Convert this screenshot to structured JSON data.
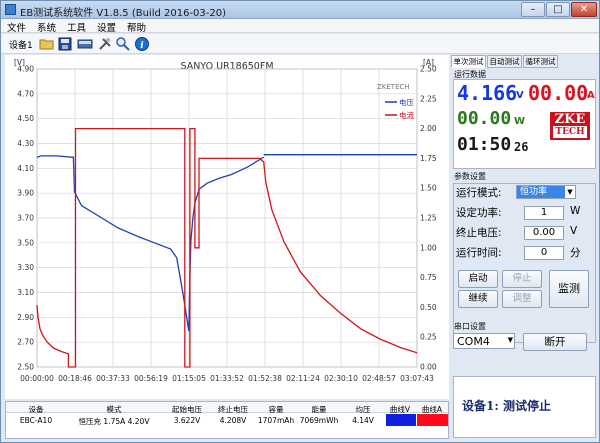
{
  "title": "EB测试系统软件 V1.8.5 (Build 2016-03-20)",
  "window_buttons": {
    "min": "–",
    "max": "□",
    "close": "✕"
  },
  "menu": [
    "文件",
    "系统",
    "工具",
    "设置",
    "帮助"
  ],
  "device_tab": "设备1",
  "toolbar_icons": [
    "open-folder-icon",
    "save-disk-icon",
    "monitor-icon",
    "tools-icon",
    "zoom-icon",
    "info-icon"
  ],
  "chart_data": {
    "type": "line",
    "title": "SANYO UR18650FM",
    "watermark": "ZKETECH",
    "left_unit": "[V]",
    "right_unit": "[A]",
    "y_left_ticks": [
      "4.90",
      "4.70",
      "4.50",
      "4.30",
      "4.10",
      "3.90",
      "3.70",
      "3.50",
      "3.30",
      "3.10",
      "2.90",
      "2.70",
      "2.50"
    ],
    "y_right_ticks": [
      "2.50",
      "2.25",
      "2.00",
      "1.75",
      "1.50",
      "1.25",
      "1.00",
      "0.75",
      "0.50",
      "0.25",
      "0.00"
    ],
    "x_ticks": [
      "00:00:00",
      "00:18:46",
      "00:37:33",
      "00:56:19",
      "01:15:05",
      "01:33:52",
      "01:52:38",
      "02:11:24",
      "02:30:10",
      "02:48:57",
      "03:07:43"
    ],
    "ylim_left": [
      2.5,
      4.9
    ],
    "ylim_right": [
      0,
      2.5
    ],
    "legend": [
      {
        "name": "电压",
        "color": "#1f3fb6"
      },
      {
        "name": "电流",
        "color": "#d0161b"
      }
    ],
    "series": [
      {
        "name": "电压",
        "axis": "left",
        "color": "#1f3fb6",
        "x_minutes": [
          0,
          2,
          10,
          17,
          18,
          18.5,
          22,
          26,
          32,
          40,
          50,
          58,
          66,
          69,
          72,
          75,
          75.5,
          76,
          77,
          78,
          80,
          84,
          90,
          96,
          100,
          104,
          108,
          112
        ],
        "values": [
          4.19,
          4.2,
          4.2,
          4.19,
          4.19,
          3.91,
          3.8,
          3.76,
          3.7,
          3.62,
          3.55,
          3.5,
          3.45,
          3.38,
          3.1,
          2.79,
          3.22,
          3.52,
          3.7,
          3.82,
          3.93,
          3.98,
          4.02,
          4.05,
          4.08,
          4.11,
          4.15,
          4.19
        ]
      },
      {
        "name": "电压",
        "axis": "left",
        "color": "#1f3fb6",
        "x_minutes": [
          112,
          150,
          187.7
        ],
        "values": [
          4.21,
          4.21,
          4.21
        ]
      },
      {
        "name": "电流",
        "axis": "right",
        "color": "#d0161b",
        "x_minutes": [
          0,
          0.5,
          1.5,
          3,
          5,
          8,
          12,
          15.5,
          15.5,
          19,
          19,
          73,
          73,
          75.5,
          75.5,
          78,
          78,
          80,
          80,
          110,
          112,
          113,
          116,
          122,
          130,
          140,
          150,
          160,
          170,
          180,
          187.7
        ],
        "values": [
          0.52,
          0.42,
          0.32,
          0.26,
          0.21,
          0.16,
          0.13,
          0.11,
          0.0,
          0.0,
          2.0,
          2.0,
          0.0,
          0.0,
          2.0,
          2.0,
          1.0,
          1.0,
          1.75,
          1.75,
          1.72,
          1.55,
          1.32,
          1.05,
          0.8,
          0.6,
          0.45,
          0.32,
          0.23,
          0.16,
          0.12
        ]
      }
    ]
  },
  "table": {
    "headers": [
      "设备",
      "模式",
      "起始电压",
      "终止电压",
      "容量",
      "能量",
      "均压",
      "曲线V",
      "曲线A"
    ],
    "row": [
      "EBC-A10",
      "恒压充 1.75A 4.20V",
      "3.622V",
      "4.208V",
      "1707mAh",
      "7069mWh",
      "4.14V",
      "",
      ""
    ],
    "curve_v_color": "#1020e0",
    "curve_a_color": "#ff0a1a"
  },
  "side_tabs": [
    "单次测试",
    "自动测试",
    "循环测试"
  ],
  "run_data_label": "运行数据",
  "lcd": {
    "voltage": "4.166",
    "voltage_unit": "V",
    "current": "00.00",
    "current_unit": "A",
    "power": "00.00",
    "power_unit": "W",
    "time": "01:50",
    "time_sec": "26",
    "logo_top": "ZKE",
    "logo_bottom": "TECH",
    "voltage_color": "#1436e6",
    "current_color": "#e0101c",
    "power_color": "#2a7a1c",
    "time_color": "#1a1a1a"
  },
  "params_label": "参数设置",
  "params": {
    "mode_label": "运行模式:",
    "mode_value": "恒功率",
    "power_label": "设定功率:",
    "power_value": "1",
    "power_unit": "W",
    "endv_label": "终止电压:",
    "endv_value": "0.00",
    "endv_unit": "V",
    "time_label": "运行时间:",
    "time_value": "0",
    "time_unit": "分"
  },
  "buttons": {
    "start": "启动",
    "stop": "停止",
    "continue": "继续",
    "adjust": "调整",
    "monitor": "监测"
  },
  "serial_label": "串口设置",
  "serial": {
    "port": "COM4",
    "open": "断开"
  },
  "status_text": "设备1: 测试停止"
}
